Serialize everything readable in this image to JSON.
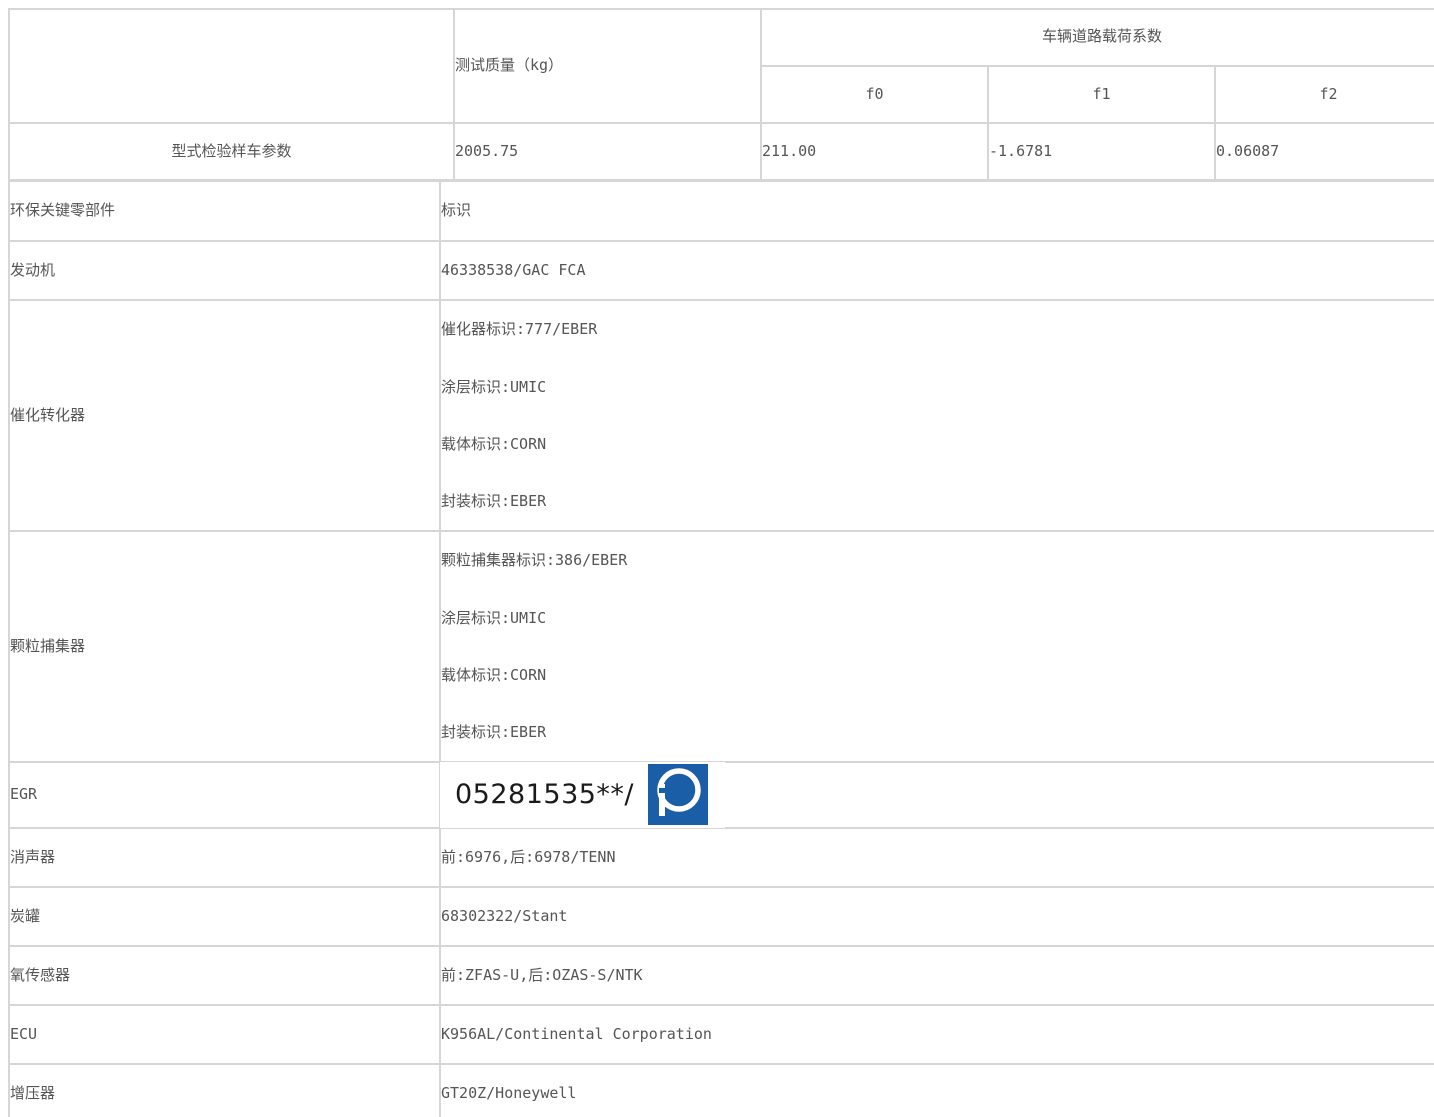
{
  "table1": {
    "header": {
      "test_mass": "测试质量（kg）",
      "coefficients": "车辆道路载荷系数",
      "f0": "f0",
      "f1": "f1",
      "f2": "f2"
    },
    "row": {
      "label": "型式检验样车参数",
      "test_mass": "2005.75",
      "f0": "211.00",
      "f1": "-1.6781",
      "f2": "0.06087"
    }
  },
  "table2": {
    "header": {
      "component": "环保关键零部件",
      "marking": "标识"
    },
    "rows": [
      {
        "component": "发动机",
        "values": [
          "46338538/GAC FCA"
        ]
      },
      {
        "component": "催化转化器",
        "values": [
          "催化器标识:777/EBER",
          "涂层标识:UMIC",
          "载体标识:CORN",
          "封装标识:EBER"
        ]
      },
      {
        "component": "颗粒捕集器",
        "values": [
          "颗粒捕集器标识:386/EBER",
          "涂层标识:UMIC",
          "载体标识:CORN",
          "封装标识:EBER"
        ]
      },
      {
        "component": "EGR",
        "image_text": "05281535**/",
        "image_logo": "p-logo-icon"
      },
      {
        "component": "消声器",
        "values": [
          "前:6976,后:6978/TENN"
        ]
      },
      {
        "component": "炭罐",
        "values": [
          "68302322/Stant"
        ]
      },
      {
        "component": "氧传感器",
        "values": [
          "前:ZFAS-U,后:OZAS-S/NTK"
        ]
      },
      {
        "component": "ECU",
        "values": [
          "K956AL/Continental Corporation"
        ]
      },
      {
        "component": "增压器",
        "values": [
          "GT20Z/Honeywell"
        ]
      }
    ]
  },
  "colors": {
    "text": "#555555",
    "border": "#d6d6d6",
    "logo": "#1a5ea8"
  }
}
